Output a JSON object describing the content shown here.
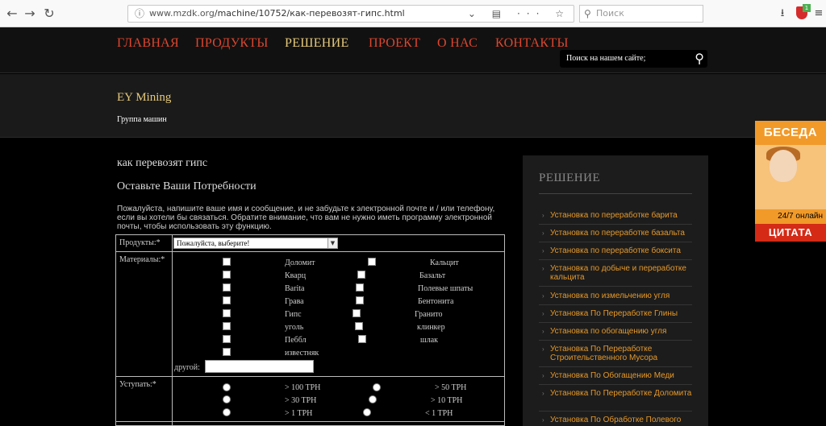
{
  "browser": {
    "url_host": "www.mzdk.org",
    "url_path": "/machine/10752/как-перевозят-гипс.html",
    "search_placeholder": "Поиск",
    "badge_count": "1"
  },
  "nav": {
    "items": [
      {
        "label": "ГЛАВНАЯ"
      },
      {
        "label": "ПРОДУКТЫ"
      },
      {
        "label": "РЕШЕНИЕ"
      },
      {
        "label": "ПРОЕКТ"
      },
      {
        "label": "О НАС"
      },
      {
        "label": "КОНТАКТЫ"
      }
    ],
    "active_color": "#e6c97a",
    "link_color": "#e0452d",
    "search_placeholder": "Поиск на нашем сайте;"
  },
  "brand": {
    "title": "EY Mining",
    "subtitle": "Группа машин"
  },
  "main": {
    "page_title": "как перевозят гипс",
    "form_heading": "Оставьте Ваши Потребности",
    "intro": "Пожалуйста, напишите ваше имя и сообщение, и не забудьте к электронной почте и / или телефону, если вы хотели бы связаться. Обратите внимание, что вам не нужно иметь программу электронной почты, чтобы использовать эту функцию."
  },
  "form": {
    "products_label": "Продукты:*",
    "products_selected": "Пожалуйста, выберите!",
    "materials_label": "Материалы:*",
    "materials": [
      "Доломит",
      "Кальцит",
      "Кварц",
      "Базальт",
      "Barita",
      "Полевые шпаты",
      "Грава",
      "Бентонита",
      "Гипс",
      "Гранито",
      "уголь",
      "клинкер",
      "Пеббл",
      "шлак",
      "известняк"
    ],
    "other_label": "другой:",
    "capacity_label": "Уступать:*",
    "capacity_options": [
      "> 100 TPH",
      "> 50 TPH",
      "> 30 TPH",
      "> 10 TPH",
      "> 1 TPH",
      "< 1 TPH"
    ]
  },
  "sidebar": {
    "title": "РЕШЕНИЕ",
    "links": [
      "Установка по переработке барита",
      "Установка по переработке базальта",
      "Установка по переработке боксита",
      "Установка по добыче и переработке кальцита",
      "Установка по измельчению угля",
      "Установка По Переработке Глины",
      "Установка по обогащению угля",
      "Установка По Переработке Строительственного Мусора",
      "Установка По Обогащению Меди",
      "Установка По Переработке Доломита",
      "Установка По Обработке Полевого"
    ]
  },
  "chat": {
    "top": "БЕСЕДА",
    "status": "24/7 онлайн",
    "bottom": "ЦИТАТА"
  }
}
